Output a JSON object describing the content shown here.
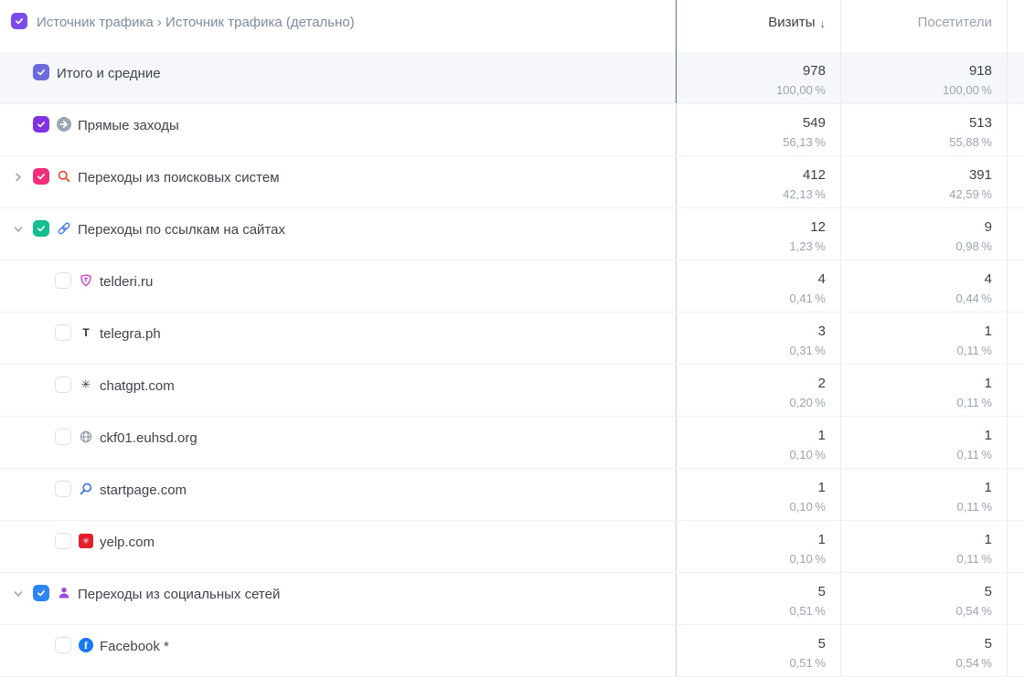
{
  "header": {
    "title": "Источник трафика › Источник трафика (детально)",
    "columns": [
      {
        "label": "Визиты",
        "sort_arrow": "↓"
      },
      {
        "label": "Посетители",
        "sort_arrow": ""
      }
    ]
  },
  "palette": {
    "ui": {
      "text": "#3e434c",
      "num": "#3a3f48",
      "muted": "#9ba4b2",
      "muted_head": "#98a2b0",
      "title": "#7c8ba1",
      "totals_bg": "#f5f7fa",
      "row_line": "#eef1f5",
      "first_col_line": "#c9d1db",
      "first_col_dark": "#5f7095",
      "metric_col_line": "#e9edf3",
      "chevron": "#99a3b2"
    },
    "icons": {
      "direct-traffic": "#9aa6b4",
      "search-engine": "#e8503c",
      "site-links": "#4a80f5",
      "social-person": "#9b4fd8",
      "telderi": "#e23bbf",
      "telegraph": "#2b2f36",
      "chatgpt": "#3a3f46",
      "globe": "#8d97a6",
      "startpage": "#3f76e8",
      "yelp": "#e31e2d",
      "facebook": "#1877f2"
    },
    "select_all_checkbox": "#7b4ce9"
  },
  "rows": [
    {
      "label": "Итого и средние",
      "level": 0,
      "totals": true,
      "chevron": null,
      "checkbox": {
        "checked": true,
        "color": "#6b6bdd"
      },
      "icon": null,
      "visits": "978",
      "visits_pct": "100,00 %",
      "visitors": "918",
      "visitors_pct": "100,00 %"
    },
    {
      "label": "Прямые заходы",
      "level": 0,
      "totals": false,
      "chevron": null,
      "checkbox": {
        "checked": true,
        "color": "#8133e3"
      },
      "icon": "direct-traffic",
      "visits": "549",
      "visits_pct": "56,13 %",
      "visitors": "513",
      "visitors_pct": "55,88 %"
    },
    {
      "label": "Переходы из поисковых систем",
      "level": 0,
      "totals": false,
      "chevron": "right",
      "checkbox": {
        "checked": true,
        "color": "#ef2f7c"
      },
      "icon": "search-engine",
      "visits": "412",
      "visits_pct": "42,13 %",
      "visitors": "391",
      "visitors_pct": "42,59 %"
    },
    {
      "label": "Переходы по ссылкам на сайтах",
      "level": 0,
      "totals": false,
      "chevron": "down",
      "checkbox": {
        "checked": true,
        "color": "#14bd8c"
      },
      "icon": "site-links",
      "visits": "12",
      "visits_pct": "1,23 %",
      "visitors": "9",
      "visitors_pct": "0,98 %"
    },
    {
      "label": "telderi.ru",
      "level": 1,
      "totals": false,
      "chevron": null,
      "checkbox": {
        "checked": false,
        "color": null
      },
      "icon": "telderi",
      "visits": "4",
      "visits_pct": "0,41 %",
      "visitors": "4",
      "visitors_pct": "0,44 %"
    },
    {
      "label": "telegra.ph",
      "level": 1,
      "totals": false,
      "chevron": null,
      "checkbox": {
        "checked": false,
        "color": null
      },
      "icon": "telegraph",
      "visits": "3",
      "visits_pct": "0,31 %",
      "visitors": "1",
      "visitors_pct": "0,11 %"
    },
    {
      "label": "chatgpt.com",
      "level": 1,
      "totals": false,
      "chevron": null,
      "checkbox": {
        "checked": false,
        "color": null
      },
      "icon": "chatgpt",
      "visits": "2",
      "visits_pct": "0,20 %",
      "visitors": "1",
      "visitors_pct": "0,11 %"
    },
    {
      "label": "ckf01.euhsd.org",
      "level": 1,
      "totals": false,
      "chevron": null,
      "checkbox": {
        "checked": false,
        "color": null
      },
      "icon": "globe",
      "visits": "1",
      "visits_pct": "0,10 %",
      "visitors": "1",
      "visitors_pct": "0,11 %"
    },
    {
      "label": "startpage.com",
      "level": 1,
      "totals": false,
      "chevron": null,
      "checkbox": {
        "checked": false,
        "color": null
      },
      "icon": "startpage",
      "visits": "1",
      "visits_pct": "0,10 %",
      "visitors": "1",
      "visitors_pct": "0,11 %"
    },
    {
      "label": "yelp.com",
      "level": 1,
      "totals": false,
      "chevron": null,
      "checkbox": {
        "checked": false,
        "color": null
      },
      "icon": "yelp",
      "visits": "1",
      "visits_pct": "0,10 %",
      "visitors": "1",
      "visitors_pct": "0,11 %"
    },
    {
      "label": "Переходы из социальных сетей",
      "level": 0,
      "totals": false,
      "chevron": "down",
      "checkbox": {
        "checked": true,
        "color": "#2e84f3"
      },
      "icon": "social-person",
      "visits": "5",
      "visits_pct": "0,51 %",
      "visitors": "5",
      "visitors_pct": "0,54 %"
    },
    {
      "label": "Facebook *",
      "level": 1,
      "totals": false,
      "chevron": null,
      "checkbox": {
        "checked": false,
        "color": null
      },
      "icon": "facebook",
      "visits": "5",
      "visits_pct": "0,51 %",
      "visitors": "5",
      "visitors_pct": "0,54 %"
    }
  ]
}
